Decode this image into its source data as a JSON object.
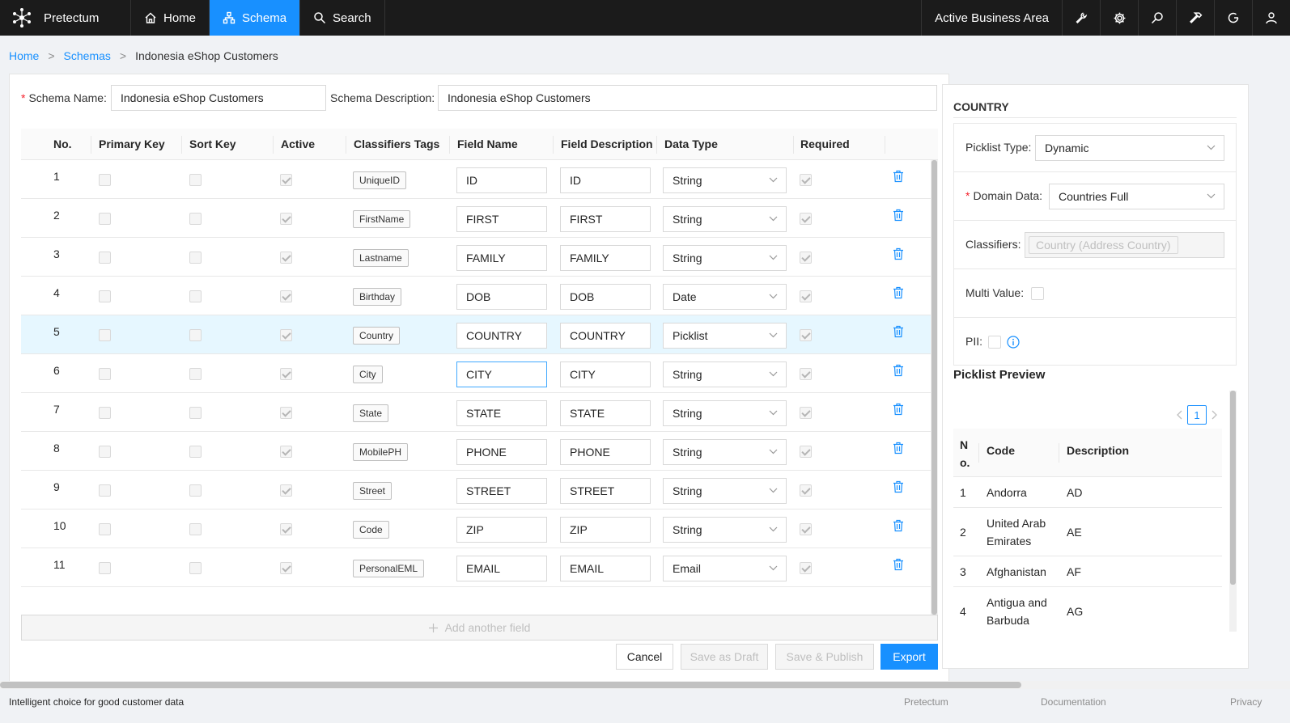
{
  "app": {
    "name": "Pretectum"
  },
  "nav": [
    {
      "label": "Home",
      "icon": "home-icon",
      "active": false
    },
    {
      "label": "Schema",
      "icon": "schema-icon",
      "active": true
    },
    {
      "label": "Search",
      "icon": "search-icon",
      "active": false
    }
  ],
  "topright": {
    "business_area": "Active Business Area",
    "icons": [
      "wrench-icon",
      "gear-icon",
      "zoom-icon",
      "hammer-icon",
      "refresh-icon",
      "user-icon"
    ]
  },
  "breadcrumb": [
    "Home",
    "Schemas",
    "Indonesia eShop Customers"
  ],
  "form": {
    "schema_name_label": "Schema Name",
    "schema_name": "Indonesia eShop Customers",
    "schema_desc_label": "Schema Description",
    "schema_desc": "Indonesia eShop Customers"
  },
  "table": {
    "headers": [
      "No.",
      "Primary Key",
      "Sort Key",
      "Active",
      "Classifiers Tags",
      "Field Name",
      "Field Description",
      "Data Type",
      "Required"
    ],
    "rows": [
      {
        "no": "1",
        "tag": "UniqueID",
        "name": "ID",
        "desc": "ID",
        "type": "String"
      },
      {
        "no": "2",
        "tag": "FirstName",
        "name": "FIRST",
        "desc": "FIRST",
        "type": "String"
      },
      {
        "no": "3",
        "tag": "Lastname",
        "name": "FAMILY",
        "desc": "FAMILY",
        "type": "String"
      },
      {
        "no": "4",
        "tag": "Birthday",
        "name": "DOB",
        "desc": "DOB",
        "type": "Date"
      },
      {
        "no": "5",
        "tag": "Country",
        "name": "COUNTRY",
        "desc": "COUNTRY",
        "type": "Picklist"
      },
      {
        "no": "6",
        "tag": "City",
        "name": "CITY",
        "desc": "CITY",
        "type": "String"
      },
      {
        "no": "7",
        "tag": "State",
        "name": "STATE",
        "desc": "STATE",
        "type": "String"
      },
      {
        "no": "8",
        "tag": "MobilePH",
        "name": "PHONE",
        "desc": "PHONE",
        "type": "String"
      },
      {
        "no": "9",
        "tag": "Street",
        "name": "STREET",
        "desc": "STREET",
        "type": "String"
      },
      {
        "no": "10",
        "tag": "Code",
        "name": "ZIP",
        "desc": "ZIP",
        "type": "String"
      },
      {
        "no": "11",
        "tag": "PersonalEML",
        "name": "EMAIL",
        "desc": "EMAIL",
        "type": "Email"
      }
    ],
    "add_field": "Add another field"
  },
  "buttons": {
    "cancel": "Cancel",
    "draft": "Save as Draft",
    "publish": "Save & Publish",
    "export": "Export"
  },
  "side": {
    "title": "COUNTRY",
    "picklist_type_label": "Picklist Type",
    "picklist_type": "Dynamic",
    "domain_data_label": "Domain Data",
    "domain_data": "Countries Full",
    "classifiers_label": "Classifiers",
    "classifier_tag": "Country (Address Country)",
    "multi_value_label": "Multi Value",
    "pii_label": "PII",
    "preview_title": "Picklist Preview",
    "page": "1",
    "preview_headers": [
      "N o.",
      "Code",
      "Description"
    ],
    "preview_rows": [
      {
        "no": "1",
        "code": "Andorra",
        "desc": "AD"
      },
      {
        "no": "2",
        "code": "United Arab Emirates",
        "desc": "AE"
      },
      {
        "no": "3",
        "code": "Afghanistan",
        "desc": "AF"
      },
      {
        "no": "4",
        "code": "Antigua and Barbuda",
        "desc": "AG"
      }
    ]
  },
  "footer": {
    "tagline": "Intelligent choice for good customer data",
    "links": [
      "Pretectum",
      "Documentation",
      "Privacy"
    ]
  },
  "colors": {
    "accent": "#1890ff",
    "topbar": "#1b1b1b",
    "row_highlight": "#e6f7ff"
  }
}
